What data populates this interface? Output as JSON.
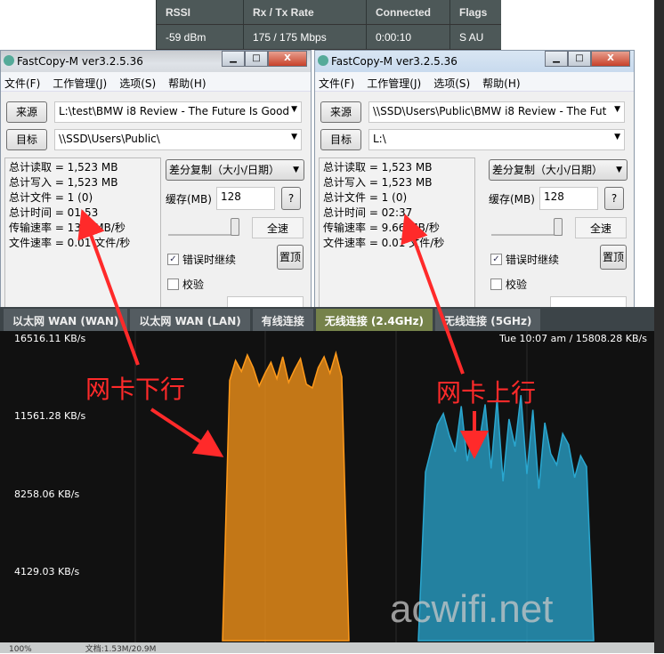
{
  "router_table": {
    "headers": [
      "RSSI",
      "Rx / Tx Rate",
      "Connected",
      "Flags"
    ],
    "values": [
      "-59 dBm",
      "175 / 175 Mbps",
      "0:00:10",
      "S AU"
    ]
  },
  "windows": [
    {
      "title": "FastCopy-M ver3.2.5.36",
      "menu": [
        "文件(F)",
        "工作管理(J)",
        "选项(S)",
        "帮助(H)"
      ],
      "source_label": "来源",
      "source": "L:\\test\\BMW i8 Review - The Future Is Good",
      "dest_label": "目标",
      "dest": "\\\\SSD\\Users\\Public\\",
      "stats": [
        "总计读取 = 1,523 MB",
        "总计写入 = 1,523 MB",
        "总计文件 = 1 (0)",
        "总计时间 = 01:53",
        "传输速率 = 13.4 MB/秒",
        "文件速率 = 0.01 文件/秒"
      ],
      "mode": "差分复制（大小/日期）",
      "buffer_label": "缓存(MB)",
      "buffer": "128",
      "help": "?",
      "fullspeed": "全速",
      "continue_on_error": "错误时继续",
      "verify": "校验",
      "top": "置顶"
    },
    {
      "title": "FastCopy-M ver3.2.5.36",
      "menu": [
        "文件(F)",
        "工作管理(J)",
        "选项(S)",
        "帮助(H)"
      ],
      "source_label": "来源",
      "source": "\\\\SSD\\Users\\Public\\BMW i8 Review - The Fut",
      "dest_label": "目标",
      "dest": "L:\\",
      "stats": [
        "总计读取 = 1,523 MB",
        "总计写入 = 1,523 MB",
        "总计文件 = 1 (0)",
        "总计时间 = 02:37",
        "传输速率 = 9.66 MB/秒",
        "文件速率 = 0.01 文件/秒"
      ],
      "mode": "差分复制（大小/日期）",
      "buffer_label": "缓存(MB)",
      "buffer": "128",
      "help": "?",
      "fullspeed": "全速",
      "continue_on_error": "错误时继续",
      "verify": "校验",
      "top": "置顶"
    }
  ],
  "tabs": [
    {
      "label": "以太网 WAN (WAN)"
    },
    {
      "label": "以太网 WAN (LAN)"
    },
    {
      "label": "有线连接"
    },
    {
      "label": "无线连接 (2.4GHz)",
      "active": true
    },
    {
      "label": "无线连接 (5GHz)"
    }
  ],
  "chart_data": {
    "type": "area",
    "y_ticks": [
      "16516.11 KB/s",
      "11561.28 KB/s",
      "8258.06 KB/s",
      "4129.03 KB/s"
    ],
    "ylim": [
      0,
      16516.11
    ],
    "readout": "Tue 10:07 am / 15808.28 KB/s",
    "series": [
      {
        "color": "#ff9a1a",
        "values": [
          14200,
          15300,
          14700,
          15600,
          14900,
          13900,
          14600,
          15200,
          14300,
          15500,
          14100,
          14800,
          15400,
          14000,
          13800,
          14900,
          15500,
          14600,
          15700,
          14400
        ]
      },
      {
        "color": "#2aa7d0",
        "values": [
          9200,
          10500,
          11800,
          12400,
          11200,
          10300,
          12800,
          9800,
          11500,
          10800,
          12900,
          9400,
          13200,
          8700,
          12100,
          10600,
          13400,
          9100,
          12600,
          8300,
          11900,
          10200,
          9600,
          11300,
          10700,
          8900,
          10100,
          9500
        ]
      }
    ]
  },
  "annotations": {
    "down": "网卡下行",
    "up": "网卡上行"
  },
  "watermark": "acwifi.net",
  "status": {
    "zoom": "100%",
    "doc": "文档:1.53M/20.9M"
  }
}
